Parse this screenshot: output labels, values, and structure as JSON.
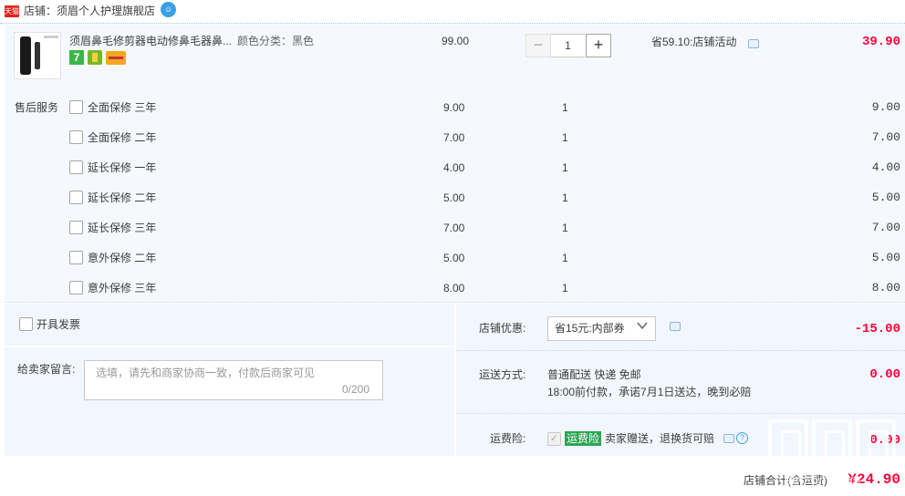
{
  "shop": {
    "badge_text": "天猫",
    "name": "店铺：须眉个人护理旗舰店",
    "chat_icon": "chat-bubble-icon"
  },
  "item": {
    "title": "须眉鼻毛修剪器电动修鼻毛器鼻...",
    "sku": "颜色分类：黑色",
    "price": "99.00",
    "quantity": "1",
    "qty_minus": "−",
    "qty_plus": "+",
    "promo": "省59.10:店铺活动",
    "subtotal": "39.90",
    "badge_seven": "7"
  },
  "services": {
    "title": "售后服务",
    "rows": [
      {
        "label": "全面保修 三年",
        "price": "9.00",
        "qty": "1",
        "total": "9.00"
      },
      {
        "label": "全面保修 二年",
        "price": "7.00",
        "qty": "1",
        "total": "7.00"
      },
      {
        "label": "延长保修 一年",
        "price": "4.00",
        "qty": "1",
        "total": "4.00"
      },
      {
        "label": "延长保修 二年",
        "price": "5.00",
        "qty": "1",
        "total": "5.00"
      },
      {
        "label": "延长保修 三年",
        "price": "7.00",
        "qty": "1",
        "total": "7.00"
      },
      {
        "label": "意外保修 二年",
        "price": "5.00",
        "qty": "1",
        "total": "5.00"
      },
      {
        "label": "意外保修 三年",
        "price": "8.00",
        "qty": "1",
        "total": "8.00"
      }
    ]
  },
  "invoice": {
    "label": "开具发票"
  },
  "message": {
    "label": "给卖家留言:",
    "placeholder": "选填，请先和商家协商一致，付款后商家可见",
    "count": "0/200"
  },
  "coupon": {
    "label": "店铺优惠:",
    "selected": "省15元:内部券",
    "amount": "-15.00"
  },
  "shipping": {
    "label": "运送方式:",
    "method": "普通配送 快递 免邮",
    "note": "18:00前付款，承诺7月1日送达，晚到必赔",
    "amount": "0.00"
  },
  "insurance": {
    "label": "运费险:",
    "checkmark": "✓",
    "tag": "运费险",
    "desc": "卖家赠送，退换货可赔",
    "help": "?",
    "amount": "0.00"
  },
  "total": {
    "label": "店铺合计(含运费)",
    "amount": "¥24.90"
  },
  "watermark": {
    "url": "smzdm.com"
  }
}
